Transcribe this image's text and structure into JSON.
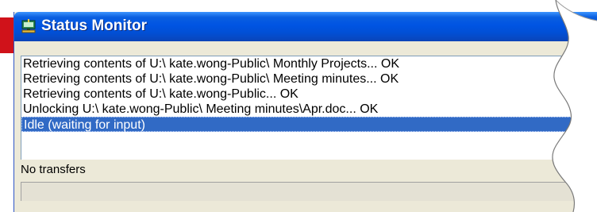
{
  "window": {
    "title": "Status Monitor",
    "icon": "network-drive-icon"
  },
  "log": {
    "lines": [
      "Retrieving contents of U:\\ kate.wong-Public\\ Monthly Projects... OK",
      "Retrieving contents of U:\\ kate.wong-Public\\ Meeting minutes... OK",
      "Retrieving contents of U:\\ kate.wong-Public... OK",
      "Unlocking U:\\ kate.wong-Public\\ Meeting minutes\\Apr.doc... OK",
      "Idle (waiting for input)"
    ],
    "selected_index": 4
  },
  "status": {
    "transfers": "No transfers",
    "progress": 0
  },
  "colors": {
    "titlebar": "#0054e3",
    "selection": "#316ac5",
    "window_bg": "#ece9d8",
    "accent_strip": "#d0121a"
  }
}
